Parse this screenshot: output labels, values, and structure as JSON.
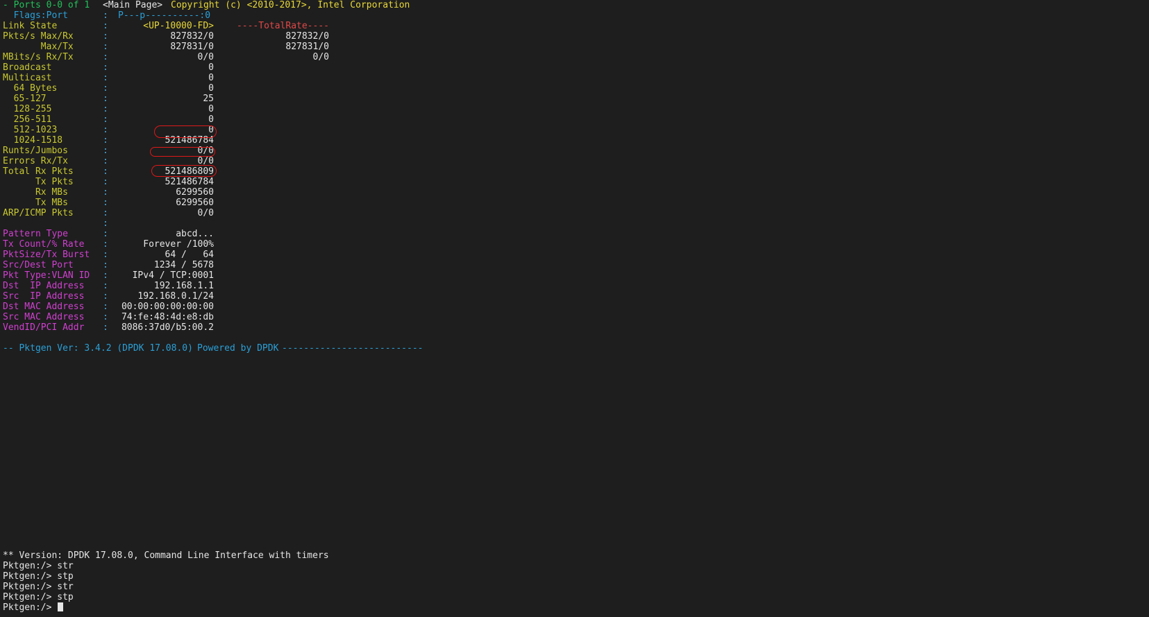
{
  "header": {
    "ports": "- Ports 0-0 of 1",
    "page": "<Main Page>",
    "copyright": "Copyright (c) <2010-2017>, Intel Corporation"
  },
  "flags_row": {
    "label": "  Flags:Port",
    "colon": ":",
    "value": "P---p----------:0"
  },
  "link_row": {
    "label": "Link State",
    "colon": ":",
    "value": "<UP-10000-FD>",
    "total_header": "----TotalRate----"
  },
  "stats": [
    {
      "label": "Pkts/s Max/Rx",
      "value": "827832/0",
      "total": "827832/0"
    },
    {
      "label": "       Max/Tx",
      "value": "827831/0",
      "total": "827831/0"
    },
    {
      "label": "MBits/s Rx/Tx",
      "value": "0/0",
      "total": "0/0"
    },
    {
      "label": "Broadcast",
      "value": "0",
      "total": ""
    },
    {
      "label": "Multicast",
      "value": "0",
      "total": ""
    },
    {
      "label": "  64 Bytes",
      "value": "0",
      "total": ""
    },
    {
      "label": "  65-127",
      "value": "25",
      "total": ""
    },
    {
      "label": "  128-255",
      "value": "0",
      "total": ""
    },
    {
      "label": "  256-511",
      "value": "0",
      "total": ""
    },
    {
      "label": "  512-1023",
      "value": "0",
      "total": ""
    },
    {
      "label": "  1024-1518",
      "value": "521486784",
      "total": ""
    },
    {
      "label": "Runts/Jumbos",
      "value": "0/0",
      "total": ""
    },
    {
      "label": "Errors Rx/Tx",
      "value": "0/0",
      "total": ""
    },
    {
      "label": "Total Rx Pkts",
      "value": "521486809",
      "total": ""
    },
    {
      "label": "      Tx Pkts",
      "value": "521486784",
      "total": ""
    },
    {
      "label": "      Rx MBs",
      "value": "6299560",
      "total": ""
    },
    {
      "label": "      Tx MBs",
      "value": "6299560",
      "total": ""
    },
    {
      "label": "ARP/ICMP Pkts",
      "value": "0/0",
      "total": ""
    },
    {
      "label": "",
      "value": "",
      "total": ""
    }
  ],
  "config": [
    {
      "label": "Pattern Type",
      "value": "abcd..."
    },
    {
      "label": "Tx Count/% Rate",
      "value": "Forever /100%"
    },
    {
      "label": "PktSize/Tx Burst",
      "value": "64 /   64"
    },
    {
      "label": "Src/Dest Port",
      "value": "1234 / 5678"
    },
    {
      "label": "Pkt Type:VLAN ID",
      "value": "IPv4 / TCP:0001"
    },
    {
      "label": "Dst  IP Address",
      "value": "192.168.1.1"
    },
    {
      "label": "Src  IP Address",
      "value": "192.168.0.1/24"
    },
    {
      "label": "Dst MAC Address",
      "value": "00:00:00:00:00:00"
    },
    {
      "label": "Src MAC Address",
      "value": "74:fe:48:4d:e8:db"
    },
    {
      "label": "VendID/PCI Addr",
      "value": "8086:37d0/b5:00.2"
    }
  ],
  "footer": {
    "version": "-- Pktgen Ver: 3.4.2 (DPDK 17.08.0)",
    "powered": "Powered by DPDK",
    "dashes": "--------------------------"
  },
  "cli": {
    "version_line": "** Version: DPDK 17.08.0, Command Line Interface with timers",
    "history": [
      "Pktgen:/> str",
      "Pktgen:/> stp",
      "Pktgen:/> str",
      "Pktgen:/> stp"
    ],
    "prompt": "Pktgen:/> "
  },
  "colors": {
    "background": "#1e1e1e",
    "label": "#c8c832",
    "config_label": "#d040d0",
    "cyan": "#2aa0d8",
    "annotation": "#e01818"
  }
}
